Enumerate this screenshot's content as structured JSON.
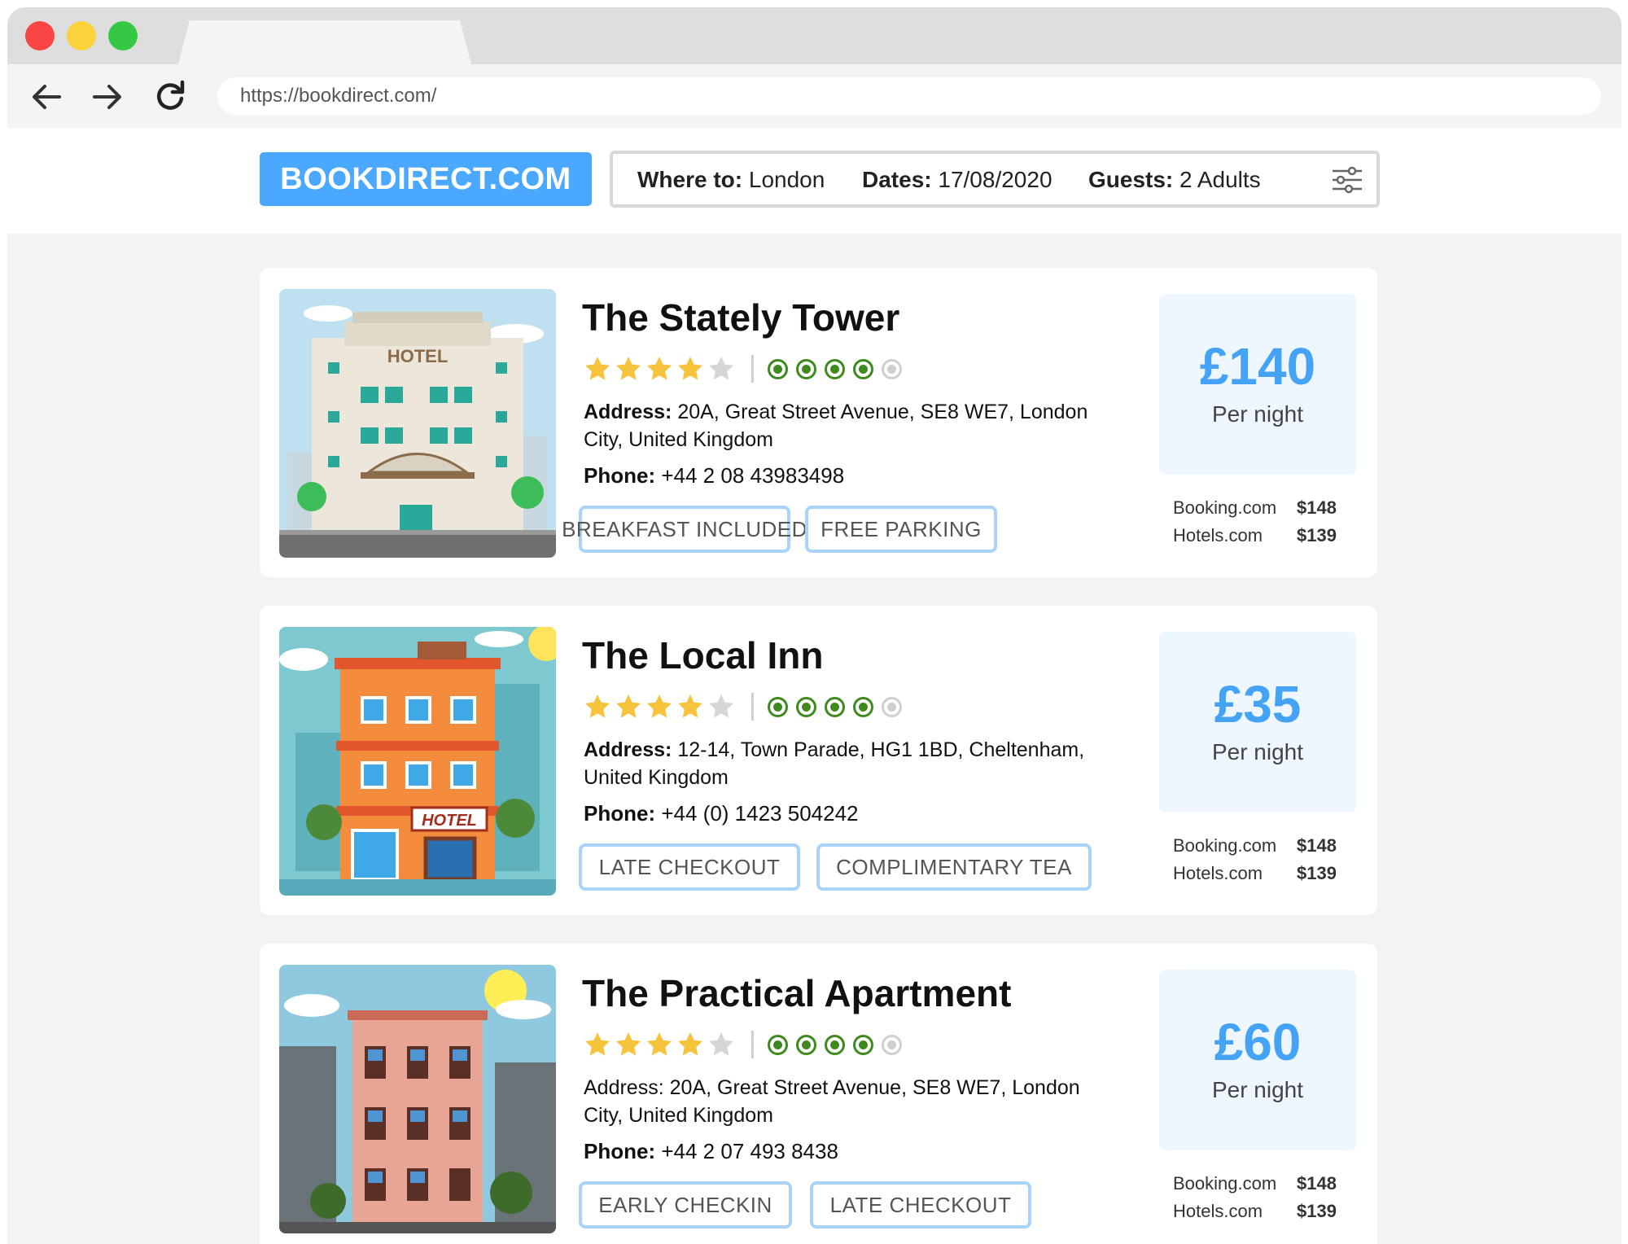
{
  "browser": {
    "url": "https://bookdirect.com/"
  },
  "header": {
    "logo": "BOOKDIRECT.COM",
    "search": {
      "where_label": "Where to:",
      "where_value": "London",
      "dates_label": "Dates:",
      "dates_value": "17/08/2020",
      "guests_label": "Guests:",
      "guests_value": "2 Adults"
    }
  },
  "colors": {
    "accent": "#4aa8ff",
    "price": "#44a3f5",
    "chip_border": "#a9d3fb",
    "star": "#f6c33d",
    "circle": "#3f8a1e"
  },
  "labels": {
    "address": "Address:",
    "phone": "Phone:",
    "per_night": "Per night"
  },
  "hotels": [
    {
      "name": "The Stately Tower",
      "stars": 4,
      "circles": 4,
      "address": "20A, Great Street Avenue, SE8 WE7, London City, United Kingdom",
      "phone": "+44 2 08 43983498",
      "amenities": [
        "BREAKFAST INCLUDED",
        "FREE PARKING"
      ],
      "price": "£140",
      "comparisons": [
        {
          "site": "Booking.com",
          "price": "$148"
        },
        {
          "site": "Hotels.com",
          "price": "$139"
        }
      ]
    },
    {
      "name": "The Local Inn",
      "stars": 4,
      "circles": 4,
      "address": "12-14, Town Parade, HG1 1BD, Cheltenham, United Kingdom",
      "phone": "+44 (0) 1423 504242",
      "amenities": [
        "LATE CHECKOUT",
        "COMPLIMENTARY TEA"
      ],
      "price": "£35",
      "comparisons": [
        {
          "site": "Booking.com",
          "price": "$148"
        },
        {
          "site": "Hotels.com",
          "price": "$139"
        }
      ]
    },
    {
      "name": "The Practical Apartment",
      "stars": 4,
      "circles": 4,
      "address": "20A, Great Street Avenue, SE8 WE7, London City, United Kingdom",
      "phone": "+44 2 07 493 8438",
      "amenities": [
        "EARLY CHECKIN",
        "LATE CHECKOUT"
      ],
      "price": "£60",
      "comparisons": [
        {
          "site": "Booking.com",
          "price": "$148"
        },
        {
          "site": "Hotels.com",
          "price": "$139"
        }
      ]
    }
  ]
}
